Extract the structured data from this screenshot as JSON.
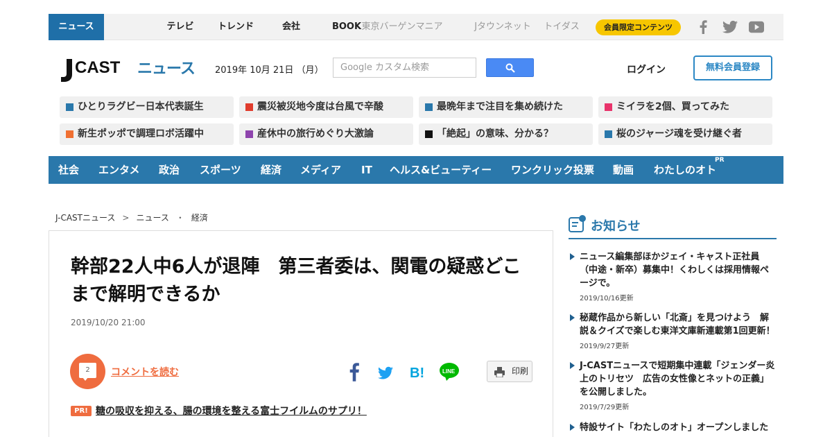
{
  "top_nav": {
    "tabs": [
      "ニュース",
      "テレビ",
      "トレンド",
      "会社",
      "BOOK"
    ],
    "partner_links": [
      "東京バーゲンマニア",
      "Jタウンネット",
      "トイダス"
    ],
    "member_button": "会員限定コンテンツ",
    "social_icons": [
      "facebook-icon",
      "twitter-icon",
      "youtube-icon"
    ]
  },
  "header": {
    "logo_text": "J-CAST ニュース",
    "date": "2019年 10月 21日 （月）",
    "search_placeholder": "Google カスタム検索",
    "login_label": "ログイン",
    "register_label": "無料会員登録"
  },
  "trending": [
    {
      "label": "ひとりラグビー日本代表誕生",
      "color": "#2a78ab"
    },
    {
      "label": "震災被災地今度は台風で辛酸",
      "color": "#e03c2d"
    },
    {
      "label": "最晩年まで注目を集め続けた",
      "color": "#2a78ab"
    },
    {
      "label": "ミイラを2個、買ってみた",
      "color": "#e8336b"
    },
    {
      "label": "新生ポッポで調理ロボ活躍中",
      "color": "#f07032"
    },
    {
      "label": "産休中の旅行めぐり大激論",
      "color": "#8e44ad"
    },
    {
      "label": "「絶起」の意味、分かる？",
      "color": "#111111"
    },
    {
      "label": "桜のジャージ魂を受け継ぐ者",
      "color": "#2a78ab"
    }
  ],
  "categories": [
    "社会",
    "エンタメ",
    "政治",
    "スポーツ",
    "経済",
    "メディア",
    "IT",
    "ヘルス&ビューティー",
    "ワンクリック投票",
    "動画",
    "わたしのオト"
  ],
  "categories_pr": "PR",
  "breadcrumb": [
    "J-CASTニュース",
    "ニュース",
    "経済"
  ],
  "breadcrumb_seps": [
    ">",
    "・"
  ],
  "article": {
    "title": "幹部22人中6人が退陣　第三者委は、関電の疑惑どこまで解明できるか",
    "published": "2019/10/20 21:00",
    "comment_count": "2",
    "comment_link": "コメントを読む",
    "share_icons": [
      "facebook-icon",
      "twitter-icon",
      "hatena-bookmark-icon",
      "line-icon"
    ],
    "print_label": "印刷",
    "pr_badge": "PR!",
    "pr_link": "糖の吸収を抑える、腸の環境を整える富士フイルムのサプリ！"
  },
  "sidebar": {
    "heading": "お知らせ",
    "items": [
      {
        "text": "ニュース編集部ほかジェイ・キャスト正社員（中途・新卒）募集中！くわしくは採用情報ページで。",
        "updated": "2019/10/16更新"
      },
      {
        "text": "秘蔵作品から新しい「北斎」を見つけよう　解説＆クイズで楽しむ東洋文庫新連載第1回更新！",
        "updated": "2019/9/27更新"
      },
      {
        "text": "J-CASTニュースで短期集中連載「ジェンダー炎上のトリセツ　広告の女性像とネットの正義」を公開しました。",
        "updated": "2019/7/29更新"
      },
      {
        "text": "特設サイト「わたしのオト」オープンしました",
        "updated": ""
      }
    ]
  },
  "colors": {
    "brand_blue": "#2a78ab",
    "accent_orange": "#ef6c3f",
    "member_yellow": "#f7c600"
  }
}
